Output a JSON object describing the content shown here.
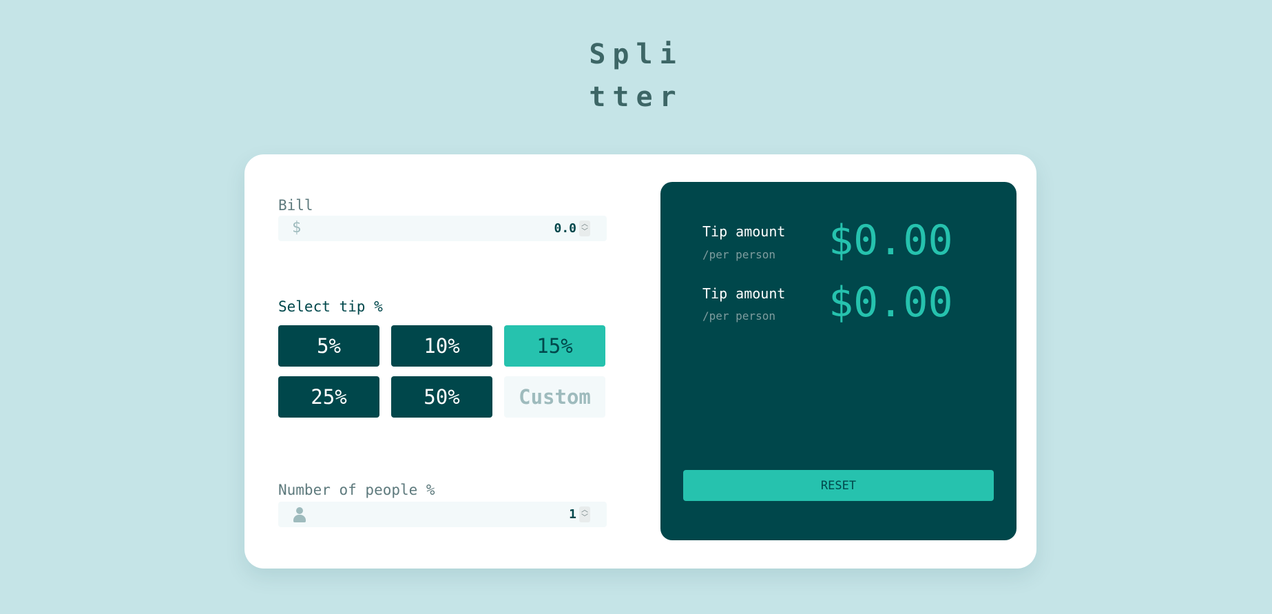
{
  "app": {
    "logo_line1": "Spli",
    "logo_line2": "tter"
  },
  "bill": {
    "label": "Bill",
    "prefix": "$",
    "value": "0.0"
  },
  "tip": {
    "label": "Select tip %",
    "options": [
      "5%",
      "10%",
      "15%",
      "25%",
      "50%"
    ],
    "selected": "15%",
    "custom_placeholder": "Custom"
  },
  "people": {
    "label": "Number of people %",
    "value": "1"
  },
  "results": {
    "rows": [
      {
        "label": "Tip amount",
        "sub": "/per person",
        "amount": "$0.00"
      },
      {
        "label": "Tip amount",
        "sub": "/per person",
        "amount": "$0.00"
      }
    ],
    "reset_label": "RESET"
  },
  "colors": {
    "background": "#c5e4e7",
    "dark_cyan": "#00474b",
    "strong_cyan": "#26c2ae",
    "input_bg": "#f3f9fa",
    "muted_text": "#5e7a7d"
  }
}
